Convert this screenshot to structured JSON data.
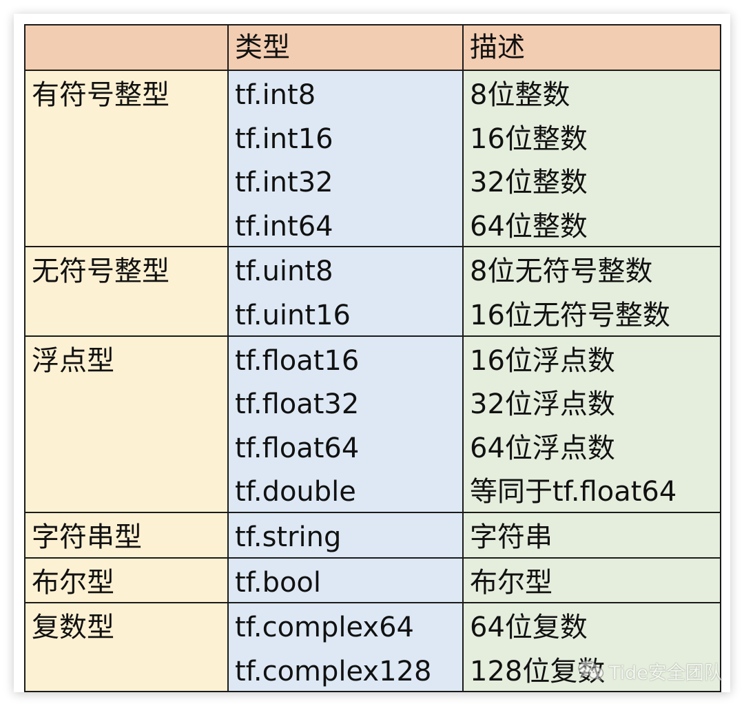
{
  "header": {
    "category": "",
    "type": "类型",
    "description": "描述"
  },
  "groups": [
    {
      "category": "有符号整型",
      "types": [
        "tf.int8",
        "tf.int16",
        "tf.int32",
        "tf.int64"
      ],
      "descriptions": [
        "8位整数",
        "16位整数",
        "32位整数",
        "64位整数"
      ]
    },
    {
      "category": "无符号整型",
      "types": [
        "tf.uint8",
        "tf.uint16"
      ],
      "descriptions": [
        "8位无符号整数",
        "16位无符号整数"
      ]
    },
    {
      "category": "浮点型",
      "types": [
        "tf.float16",
        "tf.float32",
        "tf.float64",
        "tf.double"
      ],
      "descriptions": [
        "16位浮点数",
        "32位浮点数",
        "64位浮点数",
        "等同于tf.float64"
      ]
    },
    {
      "category": "字符串型",
      "types": [
        "tf.string"
      ],
      "descriptions": [
        "字符串"
      ]
    },
    {
      "category": "布尔型",
      "types": [
        "tf.bool"
      ],
      "descriptions": [
        "布尔型"
      ]
    },
    {
      "category": "复数型",
      "types": [
        "tf.complex64",
        "tf.complex128"
      ],
      "descriptions": [
        "64位复数",
        "128位复数"
      ]
    }
  ],
  "watermark": {
    "text": "Tide安全团队",
    "icon": "wechat-icon"
  },
  "colors": {
    "header_bg": "#f3cdb1",
    "category_bg": "#fdf1d3",
    "type_bg": "#dde8f4",
    "description_bg": "#e5eedd",
    "border": "#1a1a1a"
  }
}
